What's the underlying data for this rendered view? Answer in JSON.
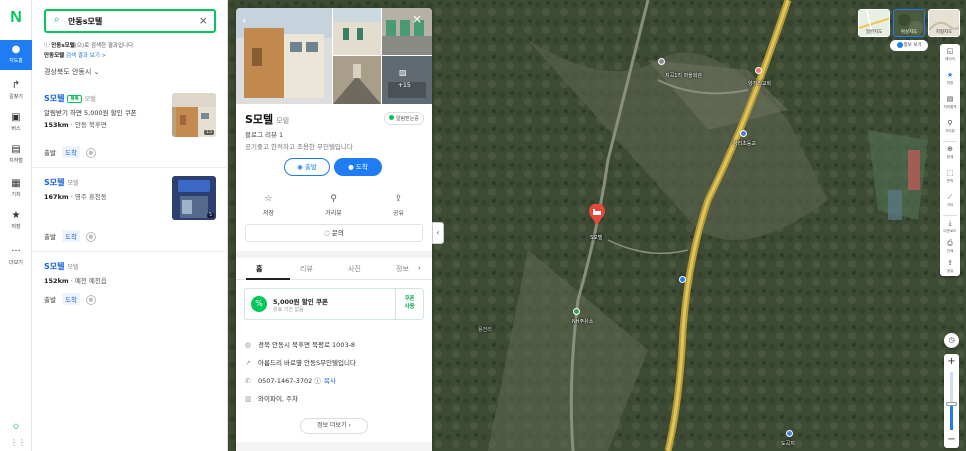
{
  "rail": {
    "logo": "N",
    "items": [
      {
        "label": "지도홈",
        "icon": "location-pin-icon",
        "active": true
      },
      {
        "label": "길찾기",
        "icon": "directions-icon"
      },
      {
        "label": "버스",
        "icon": "bus-icon"
      },
      {
        "label": "지하철",
        "icon": "subway-icon"
      },
      {
        "label": "기차",
        "icon": "train-icon"
      },
      {
        "label": "저장",
        "icon": "star-icon"
      },
      {
        "label": "더보기",
        "icon": "more-icon"
      }
    ]
  },
  "search": {
    "query": "안동s모텔",
    "notice_query": "안동s모텔",
    "notice_rest": "(으)로 검색한 결과입니다.",
    "notice_link_query": "안동모텔",
    "notice_link_rest": " 검색 결과 보기 >",
    "region": "경상북도 안동시"
  },
  "results": [
    {
      "name": "S모텔",
      "category": "모텔",
      "badge": "톡톡",
      "desc": "알림받기 하면 5,000원 할인 쿠폰",
      "distance": "153km",
      "area": "안동 북후면",
      "start": "출발",
      "arrive": "도착",
      "photo_count": "15"
    },
    {
      "name": "S모텔",
      "category": "모텔",
      "badge": "",
      "desc": "",
      "distance": "167km",
      "area": "영주 휴천동",
      "start": "출발",
      "arrive": "도착",
      "photo_count": "5"
    },
    {
      "name": "S모텔",
      "category": "모텔",
      "badge": "",
      "desc": "",
      "distance": "152km",
      "area": "예천 예천읍",
      "start": "출발",
      "arrive": "도착",
      "photo_count": ""
    }
  ],
  "detail": {
    "photo_more": "+15",
    "name": "S모텔",
    "category": "모텔",
    "alert_chip": "알림받는중",
    "blog_review": "블로그 리뷰 1",
    "description": "공기좋고 한적하고 조용한 무인텔입니다",
    "start": "출발",
    "arrive": "도착",
    "actions": [
      {
        "label": "저장",
        "icon": "star-outline-icon"
      },
      {
        "label": "거리뷰",
        "icon": "street-view-icon"
      },
      {
        "label": "공유",
        "icon": "share-icon"
      }
    ],
    "inquiry": "문의",
    "tabs": [
      "홈",
      "리뷰",
      "사진",
      "정보"
    ],
    "coupon_title": "5,000원 할인 쿠폰",
    "coupon_sub": "유효 기간 없음",
    "coupon_btn_1": "쿠폰",
    "coupon_btn_2": "사용",
    "address": "경북 안동시 북후면 북평로 1003-8",
    "route_desc": "아름드리 바로옆 안동S무인텔입니다",
    "phone": "0507-1467-3702",
    "copy": "복사",
    "amenities": "와이파이, 주차",
    "more_info": "정보 더보기"
  },
  "map": {
    "map_types": [
      "일반지도",
      "위성지도",
      "지형지도"
    ],
    "info_toggle": "정보 보기",
    "tools": [
      "레이어",
      "저장",
      "지하철역",
      "거리뷰",
      "현재",
      "면적",
      "거리",
      "다운로드",
      "인쇄",
      "공유"
    ],
    "zoom_level": 0.45,
    "labels": [
      {
        "text": "S모텔"
      },
      {
        "text": "지곡1리 마을회관"
      },
      {
        "text": "양지리교회"
      },
      {
        "text": "상리초등교"
      },
      {
        "text": "NH주유소"
      },
      {
        "text": "용천리"
      },
      {
        "text": "도곡지"
      }
    ],
    "colors": {
      "accent": "#1e7df2",
      "brand": "#03c75a",
      "road": "#d7b84a",
      "marker": "#e8473a"
    }
  }
}
